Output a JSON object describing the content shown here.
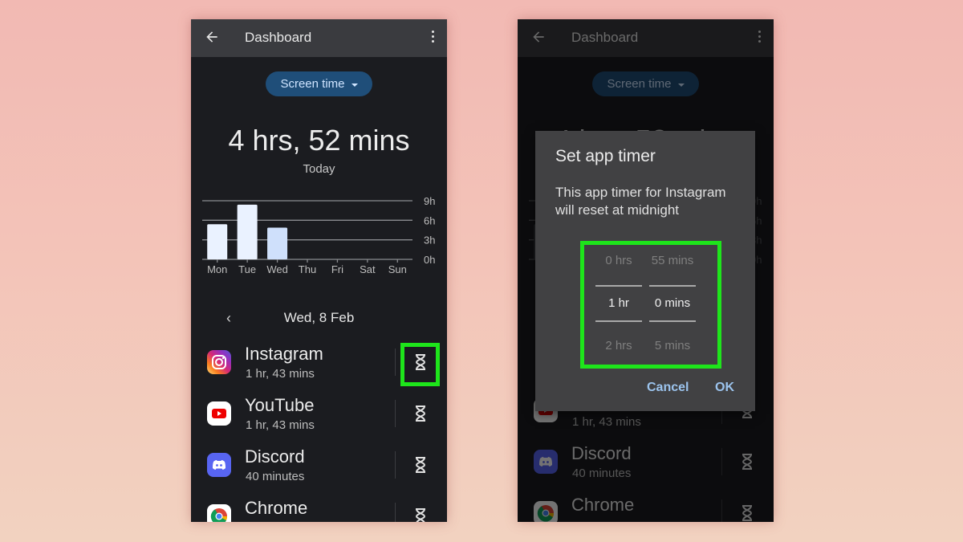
{
  "colors": {
    "highlight": "#1ee51b",
    "chip_bg": "#1f4e79",
    "bar_color": "#eaf2ff",
    "bar_selected": "#cfe0fb",
    "dialog_button": "#9cc4ee"
  },
  "left_screen": {
    "appbar": {
      "back_icon": "arrow-left-icon",
      "title": "Dashboard",
      "menu_icon": "more-vert-icon"
    },
    "chip": {
      "label": "Screen time",
      "icon": "dropdown-caret-icon"
    },
    "total_time": "4 hrs, 52 mins",
    "total_caption": "Today",
    "date_nav": {
      "prev_icon": "chevron-left-icon",
      "date": "Wed, 8 Feb"
    },
    "apps": [
      {
        "name": "Instagram",
        "time": "1 hr, 43 mins",
        "icon": "instagram-icon",
        "timer_icon": "hourglass-icon",
        "highlighted": true
      },
      {
        "name": "YouTube",
        "time": "1 hr, 43 mins",
        "icon": "youtube-icon",
        "timer_icon": "hourglass-icon",
        "highlighted": false
      },
      {
        "name": "Discord",
        "time": "40 minutes",
        "icon": "discord-icon",
        "timer_icon": "hourglass-icon",
        "highlighted": false
      },
      {
        "name": "Chrome",
        "time": "",
        "icon": "chrome-icon",
        "timer_icon": "hourglass-icon",
        "highlighted": false
      }
    ]
  },
  "right_screen": {
    "appbar": {
      "title": "Dashboard"
    },
    "chip": {
      "label": "Screen time"
    },
    "apps": [
      {
        "name": "",
        "time": "1 hr, 43 mins",
        "icon": "youtube-icon"
      },
      {
        "name": "Discord",
        "time": "40 minutes",
        "icon": "discord-icon"
      },
      {
        "name": "Chrome",
        "time": "",
        "icon": "chrome-icon"
      }
    ],
    "dialog": {
      "title": "Set app timer",
      "body": "This app timer for Instagram will reset at midnight",
      "picker": {
        "hours": {
          "above": "0 hrs",
          "selected": "1 hr",
          "below": "2 hrs"
        },
        "minutes": {
          "above": "55 mins",
          "selected": "0 mins",
          "below": "5 mins"
        }
      },
      "cancel_label": "Cancel",
      "ok_label": "OK"
    }
  },
  "chart_data": {
    "type": "bar",
    "title": "",
    "xlabel": "",
    "ylabel": "",
    "categories": [
      "Mon",
      "Tue",
      "Wed",
      "Thu",
      "Fri",
      "Sat",
      "Sun"
    ],
    "values": [
      5.4,
      8.4,
      4.87,
      0,
      0,
      0,
      0
    ],
    "selected_category": "Wed",
    "y_ticks": [
      "0h",
      "3h",
      "6h",
      "9h"
    ],
    "y_tick_values": [
      0,
      3,
      6,
      9
    ],
    "ylim": [
      0,
      9
    ],
    "grid": true,
    "y_axis_position": "right"
  }
}
